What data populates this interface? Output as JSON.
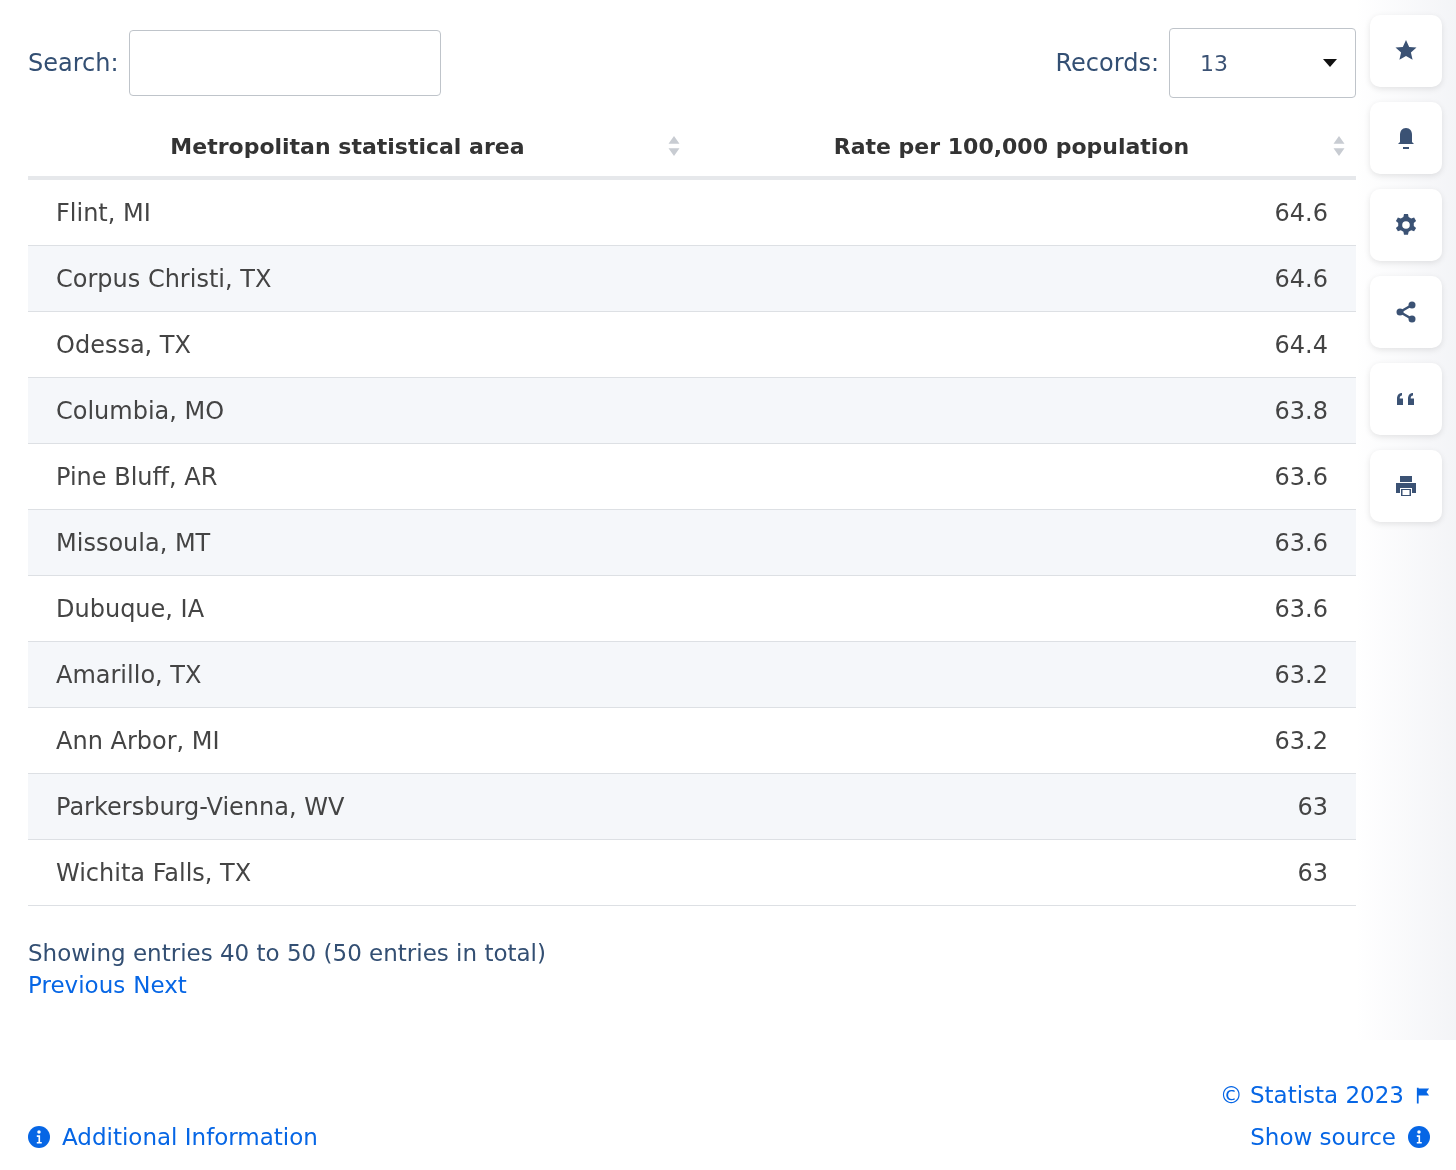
{
  "search": {
    "label": "Search:"
  },
  "records": {
    "label": "Records:",
    "value": "13"
  },
  "table": {
    "columns": [
      "Metropolitan statistical area",
      "Rate per 100,000 population"
    ],
    "rows": [
      [
        "Flint, MI",
        "64.6"
      ],
      [
        "Corpus Christi, TX",
        "64.6"
      ],
      [
        "Odessa, TX",
        "64.4"
      ],
      [
        "Columbia, MO",
        "63.8"
      ],
      [
        "Pine Bluff, AR",
        "63.6"
      ],
      [
        "Missoula, MT",
        "63.6"
      ],
      [
        "Dubuque, IA",
        "63.6"
      ],
      [
        "Amarillo, TX",
        "63.2"
      ],
      [
        "Ann Arbor, MI",
        "63.2"
      ],
      [
        "Parkersburg-Vienna, WV",
        "63"
      ],
      [
        "Wichita Falls, TX",
        "63"
      ]
    ]
  },
  "summary": "Showing entries 40 to 50 (50 entries in total)",
  "pagination": [
    "Previous",
    "Next"
  ],
  "footer": {
    "additional_info": "Additional Information",
    "copyright": "© Statista 2023",
    "show_source": "Show source"
  }
}
